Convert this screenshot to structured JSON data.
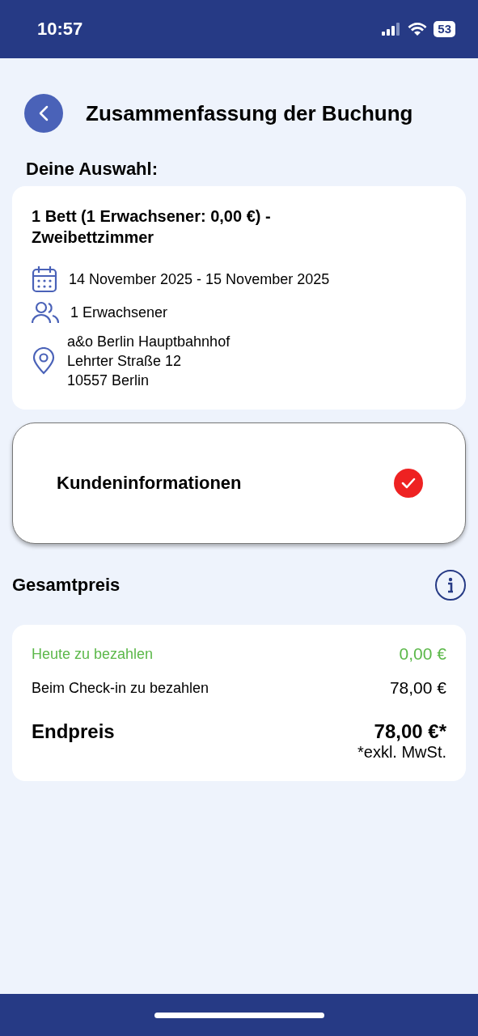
{
  "status_bar": {
    "time": "10:57",
    "battery": "53"
  },
  "header": {
    "title": "Zusammenfassung der Buchung"
  },
  "selection": {
    "heading": "Deine Auswahl:",
    "title": "1 Bett (1 Erwachsener: 0,00 €) - Zweibettzimmer",
    "dates": "14 November 2025 - 15 November 2025",
    "guests": "1 Erwachsener",
    "address": [
      "a&o Berlin Hauptbahnhof",
      "Lehrter Straße 12",
      "10557 Berlin"
    ]
  },
  "customer": {
    "label": "Kundeninformationen",
    "checked": true
  },
  "total": {
    "heading": "Gesamtpreis",
    "rows": [
      {
        "kind": "today",
        "label": "Heute zu bezahlen",
        "amount": "0,00 €"
      },
      {
        "kind": "checkin",
        "label": "Beim Check-in zu bezahlen",
        "amount": "78,00 €"
      }
    ],
    "final": {
      "label": "Endpreis",
      "amount": "78,00 €*",
      "note": "*exkl. MwSt."
    }
  }
}
